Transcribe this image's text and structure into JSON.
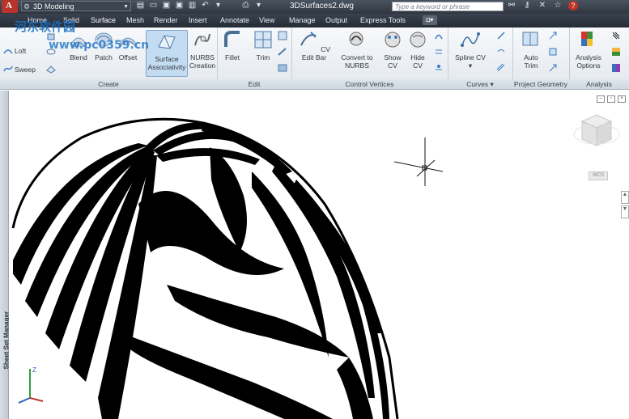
{
  "titlebar": {
    "workspace": "3D Modeling",
    "document": "3DSurfaces2.dwg",
    "search_placeholder": "Type a keyword or phrase"
  },
  "tabs": [
    {
      "label": "Home"
    },
    {
      "label": "Solid"
    },
    {
      "label": "Surface"
    },
    {
      "label": "Mesh"
    },
    {
      "label": "Render"
    },
    {
      "label": "Insert"
    },
    {
      "label": "Annotate"
    },
    {
      "label": "View"
    },
    {
      "label": "Manage"
    },
    {
      "label": "Output"
    },
    {
      "label": "Express Tools"
    }
  ],
  "ribbon": {
    "create": {
      "title": "Create",
      "loft": "Loft",
      "sweep": "Sweep",
      "blend": "Blend",
      "patch": "Patch",
      "offset": "Offset",
      "surface_associativity_1": "Surface",
      "surface_associativity_2": "Associativity",
      "nurbs_1": "NURBS",
      "nurbs_2": "Creation"
    },
    "edit": {
      "title": "Edit",
      "fillet": "Fillet",
      "trim": "Trim"
    },
    "control_vertices": {
      "title": "Control Vertices",
      "cv_edit_bar": "CV Edit Bar",
      "convert_1": "Convert to",
      "convert_2": "NURBS",
      "show_1": "Show",
      "show_2": "CV",
      "hide_1": "Hide",
      "hide_2": "CV"
    },
    "curves": {
      "title": "Curves",
      "spline_cv": "Spline CV"
    },
    "project_geometry": {
      "title": "Project Geometry",
      "auto_1": "Auto",
      "auto_2": "Trim"
    },
    "analysis": {
      "title": "Analysis",
      "options_1": "Analysis",
      "options_2": "Options"
    }
  },
  "sidebar": {
    "sheet_set_manager": "Sheet Set Manager"
  },
  "watermark": {
    "site": "河东软件园",
    "url": "www.pc0359.cn"
  },
  "viewcube": {
    "wcs": "WCS"
  },
  "icons": {
    "app_menu": "autocad-app-icon",
    "viewcube": "viewcube-icon",
    "ucs": "ucs-axis-icon",
    "crosshair": "crosshair-cursor-icon"
  }
}
